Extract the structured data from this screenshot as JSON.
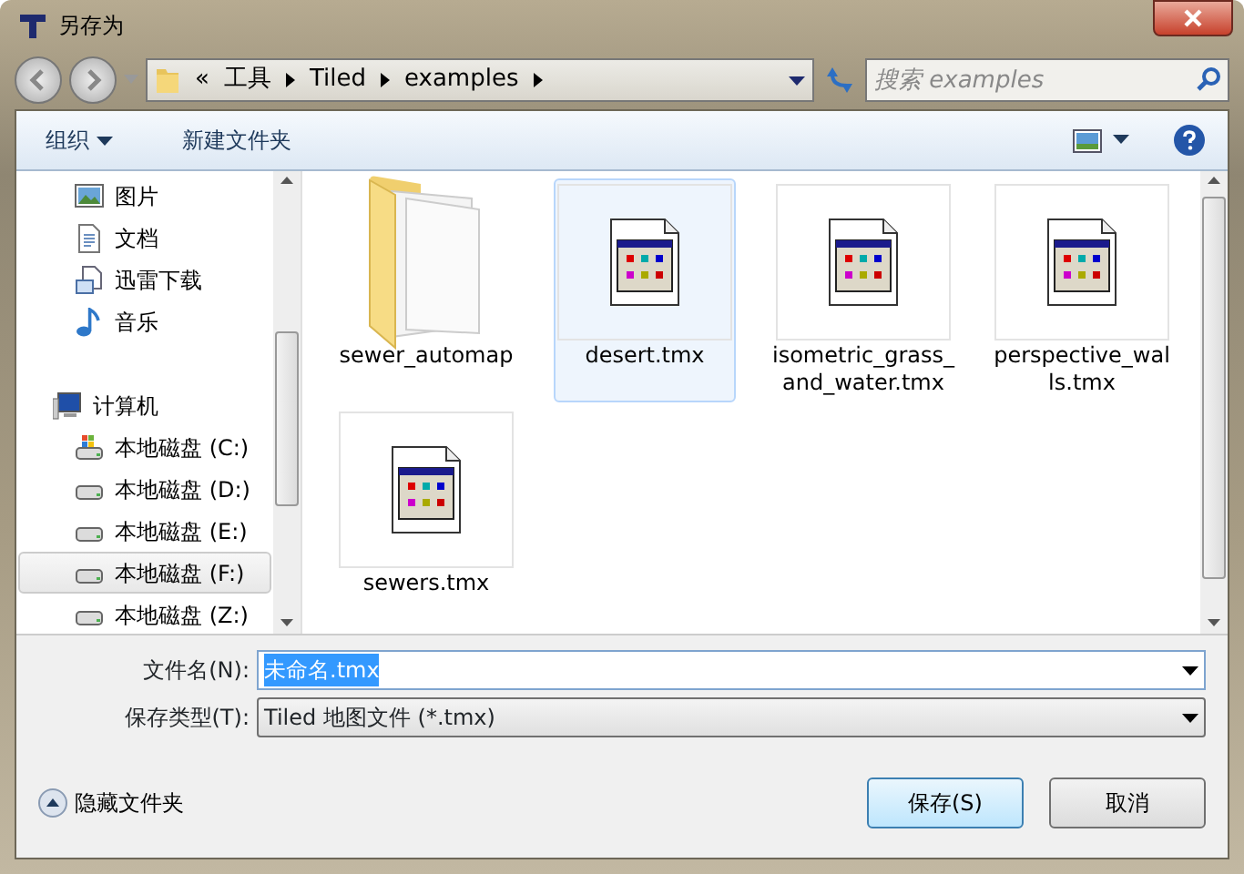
{
  "window": {
    "title": "另存为"
  },
  "address": {
    "overflow": "«",
    "crumbs": [
      "工具",
      "Tiled",
      "examples"
    ]
  },
  "search": {
    "placeholder": "搜索 examples"
  },
  "toolbar": {
    "organize": "组织",
    "new_folder": "新建文件夹"
  },
  "sidebar": {
    "items": [
      {
        "label": "图片",
        "kind": "pictures",
        "selected": false
      },
      {
        "label": "文档",
        "kind": "documents",
        "selected": false
      },
      {
        "label": "迅雷下载",
        "kind": "downloads",
        "selected": false
      },
      {
        "label": "音乐",
        "kind": "music",
        "selected": false
      },
      {
        "label": "计算机",
        "kind": "computer",
        "selected": false
      },
      {
        "label": "本地磁盘 (C:)",
        "kind": "system-drive",
        "selected": false
      },
      {
        "label": "本地磁盘 (D:)",
        "kind": "drive",
        "selected": false
      },
      {
        "label": "本地磁盘 (E:)",
        "kind": "drive",
        "selected": false
      },
      {
        "label": "本地磁盘 (F:)",
        "kind": "drive",
        "selected": true
      },
      {
        "label": "本地磁盘 (Z:)",
        "kind": "drive",
        "selected": false
      }
    ]
  },
  "files": [
    {
      "name": "sewer_automap",
      "kind": "folder",
      "selected": false
    },
    {
      "name": "desert.tmx",
      "kind": "tmx",
      "selected": true
    },
    {
      "name": "isometric_grass_and_water.tmx",
      "kind": "tmx",
      "selected": false
    },
    {
      "name": "perspective_walls.tmx",
      "kind": "tmx",
      "selected": false
    },
    {
      "name": "sewers.tmx",
      "kind": "tmx",
      "selected": false
    }
  ],
  "form": {
    "filename_label": "文件名(N):",
    "filename": "未命名.tmx",
    "filename_selected": true,
    "type_label": "保存类型(T):",
    "type": "Tiled 地图文件 (*.tmx)"
  },
  "hide_folders": "隐藏文件夹",
  "buttons": [
    {
      "label": "保存(S)",
      "default": true
    },
    {
      "label": "取消",
      "default": false
    }
  ]
}
